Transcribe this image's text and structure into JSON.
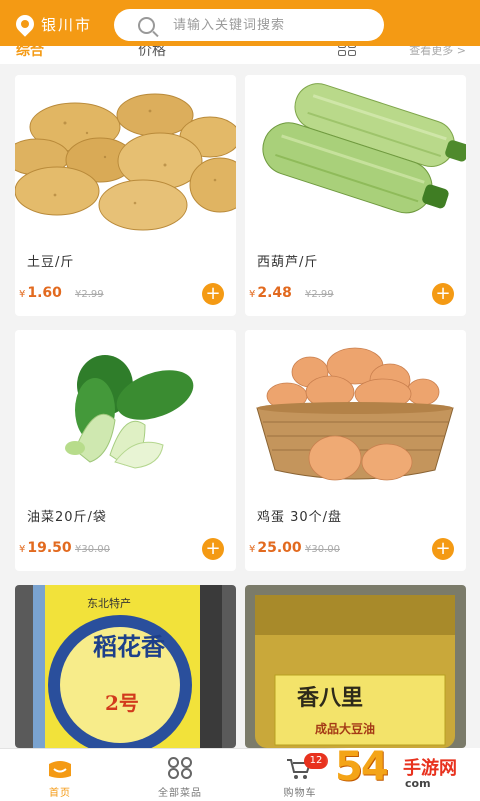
{
  "header": {
    "city": "银川市",
    "search_placeholder": "请输入关键词搜索"
  },
  "sortbar": {
    "active_label": "综合",
    "price_label": "价格",
    "view_more": "查看更多 >"
  },
  "products": [
    {
      "name": "土豆/斤",
      "price": "1.60",
      "old_price": "2.99",
      "image": "potatoes"
    },
    {
      "name": "西葫芦/斤",
      "price": "2.48",
      "old_price": "2.99",
      "image": "zucchini"
    },
    {
      "name": "油菜20斤/袋",
      "price": "19.50",
      "old_price": "30.00",
      "image": "bok-choy"
    },
    {
      "name": "鸡蛋 30个/盘",
      "price": "25.00",
      "old_price": "30.00",
      "image": "eggs"
    },
    {
      "name": "",
      "price": "",
      "old_price": "",
      "image": "rice-bag",
      "image_text": [
        "东北特产",
        "稻花香",
        "2号"
      ]
    },
    {
      "name": "",
      "price": "",
      "old_price": "",
      "image": "oil-jug",
      "image_text": [
        "香八里",
        "成品大豆油"
      ]
    }
  ],
  "currency_symbol": "¥",
  "add_label": "+",
  "tabbar": {
    "home": "首页",
    "all_products": "全部菜品",
    "cart": "购物车",
    "cart_count": "12"
  },
  "watermark": {
    "main": "54",
    "side": "手游网",
    "url": "com"
  },
  "colors": {
    "accent": "#f49a14",
    "price": "#e26a1f",
    "badge": "#e8321e"
  }
}
